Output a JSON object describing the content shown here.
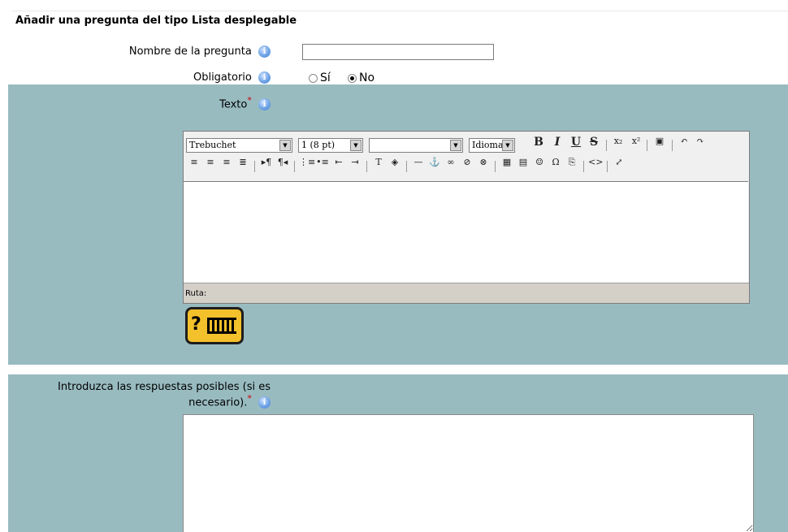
{
  "page": {
    "title": "Añadir una pregunta del tipo Lista desplegable"
  },
  "fields": {
    "name_label": "Nombre de la pregunta",
    "required_label": "Obligatorio",
    "radio_yes": "Sí",
    "radio_no": "No",
    "required_selected": "No",
    "text_label": "Texto",
    "answers_label_line1": "Introduzca las respuestas posibles (si es",
    "answers_label_line2": "necesario).",
    "required_mark": "*",
    "info_glyph": "i"
  },
  "editor": {
    "font_family": "Trebuchet",
    "font_size": "1 (8 pt)",
    "format": "",
    "language": "Idioma",
    "path_label": "Ruta:",
    "toolbar_buttons": [
      "bold",
      "italic",
      "underline",
      "strikethrough",
      "subscript",
      "superscript",
      "clean-word",
      "undo",
      "redo",
      "align-left",
      "align-center",
      "align-right",
      "justify",
      "ltr",
      "rtl",
      "ordered-list",
      "unordered-list",
      "outdent",
      "indent",
      "text-color",
      "background-color",
      "horizontal-rule",
      "anchor",
      "link",
      "unlink",
      "nolink",
      "insert-image",
      "insert-table",
      "insert-smiley",
      "insert-special-char",
      "search-replace",
      "html-source",
      "fullscreen"
    ]
  },
  "colors": {
    "band": "#98bbc0",
    "info_icon": "#5b93dc",
    "required_star": "#d00000",
    "help_icon": "#f3c12b"
  }
}
